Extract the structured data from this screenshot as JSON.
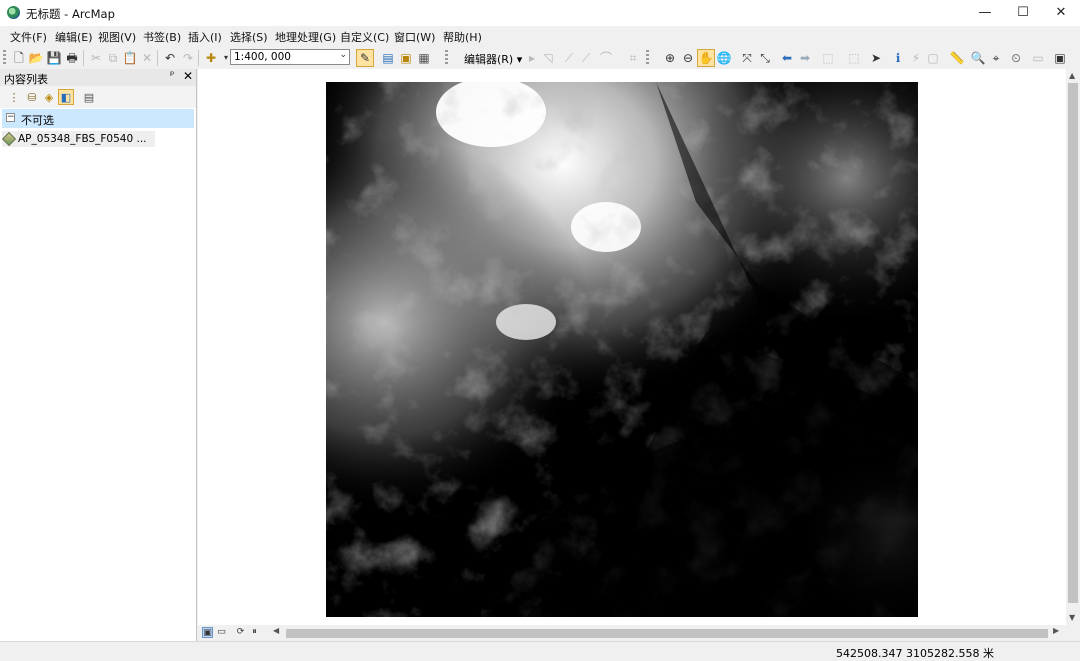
{
  "window": {
    "title": "无标题 - ArcMap",
    "minimize": "—",
    "maximize": "☐",
    "close": "✕"
  },
  "menu": [
    "文件(F)",
    "编辑(E)",
    "视图(V)",
    "书签(B)",
    "插入(I)",
    "选择(S)",
    "地理处理(G)",
    "自定义(C)",
    "窗口(W)",
    "帮助(H)"
  ],
  "toolbar": {
    "scale_value": "1:400, 000",
    "scale_arrow": "⌄",
    "editor_label": "编辑器(R) ▾",
    "glyphs": {
      "new": "🗋",
      "open": "📂",
      "save": "💾",
      "print": "🖶",
      "cut": "✂",
      "copy": "⧉",
      "paste": "📋",
      "delete": "✕",
      "undo": "↶",
      "redo": "↷",
      "add_data": "✚",
      "zoom_in": "⊕",
      "zoom_out": "⊖",
      "pan": "✋",
      "full_extent": "🌐",
      "fixed_zoom_in": "⤧",
      "fixed_zoom_out": "⤡",
      "back": "⬅",
      "forward": "➡",
      "select": "➤",
      "identify": "ℹ",
      "find": "🔍"
    }
  },
  "toc": {
    "title": "内容列表",
    "pin": "ᵖ",
    "close": "✕",
    "group": {
      "expander": "−",
      "label": "不可选"
    },
    "layer": {
      "label": "AP_05348_FBS_F0540 ..."
    }
  },
  "map": {
    "content": "grayscale elevation raster (DEM)"
  },
  "status": {
    "coordinates": "542508.347  3105282.558 米"
  },
  "colors": {
    "selection": "#cce8ff",
    "chrome": "#f0f0f0"
  }
}
